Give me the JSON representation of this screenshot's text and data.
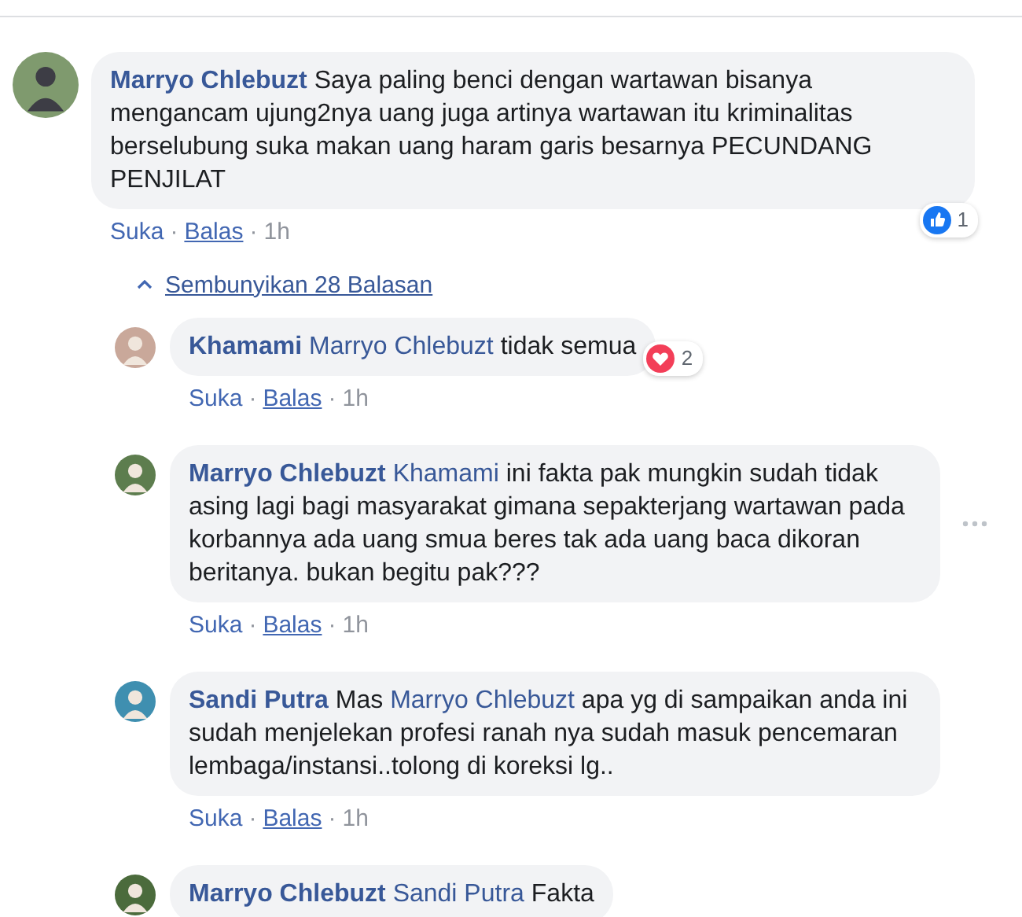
{
  "comment": {
    "author": "Marryo Chlebuzt",
    "segments": [
      {
        "kind": "plain",
        "text": "Saya paling benci dengan wartawan bisanya mengancam ujung2nya uang juga artinya wartawan itu kriminalitas berselubung suka makan uang haram garis besarnya PECUNDANG PENJILAT"
      }
    ],
    "reaction": {
      "kind": "like",
      "count": "1"
    },
    "actions": [
      "Suka",
      "·",
      "Balas",
      "·",
      "1h"
    ]
  },
  "toggle": {
    "label": "Sembunyikan 28 Balasan",
    "expanded": true
  },
  "replies": [
    {
      "author": "Khamami",
      "segments": [
        {
          "kind": "mention",
          "text": "Marryo Chlebuzt"
        },
        {
          "kind": "plain",
          "text": "tidak semua"
        }
      ],
      "reaction": {
        "kind": "love",
        "count": "2"
      },
      "show_menu": false,
      "actions": [
        "Suka",
        "·",
        "Balas",
        "·",
        "1h"
      ]
    },
    {
      "author": "Marryo Chlebuzt",
      "segments": [
        {
          "kind": "mention",
          "text": "Khamami"
        },
        {
          "kind": "plain",
          "text": "ini fakta pak mungkin sudah tidak asing lagi bagi masyarakat gimana sepakterjang wartawan pada korbannya ada uang smua beres tak ada uang baca dikoran beritanya. bukan begitu pak???"
        }
      ],
      "show_menu": true,
      "actions": [
        "Suka",
        "·",
        "Balas",
        "·",
        "1h"
      ]
    },
    {
      "author": "Sandi Putra",
      "segments": [
        {
          "kind": "plain",
          "text": "Mas"
        },
        {
          "kind": "mention",
          "text": "Marryo Chlebuzt"
        },
        {
          "kind": "plain",
          "text": "apa yg di sampaikan anda ini sudah menjelekan profesi ranah nya sudah masuk pencemaran lembaga/instansi..tolong di koreksi lg.."
        }
      ],
      "show_menu": false,
      "actions": [
        "Suka",
        "·",
        "Balas",
        "·",
        "1h"
      ]
    },
    {
      "author": "Marryo Chlebuzt",
      "segments": [
        {
          "kind": "mention",
          "text": "Sandi Putra"
        },
        {
          "kind": "plain",
          "text": "Fakta"
        }
      ],
      "show_menu": false
    }
  ]
}
